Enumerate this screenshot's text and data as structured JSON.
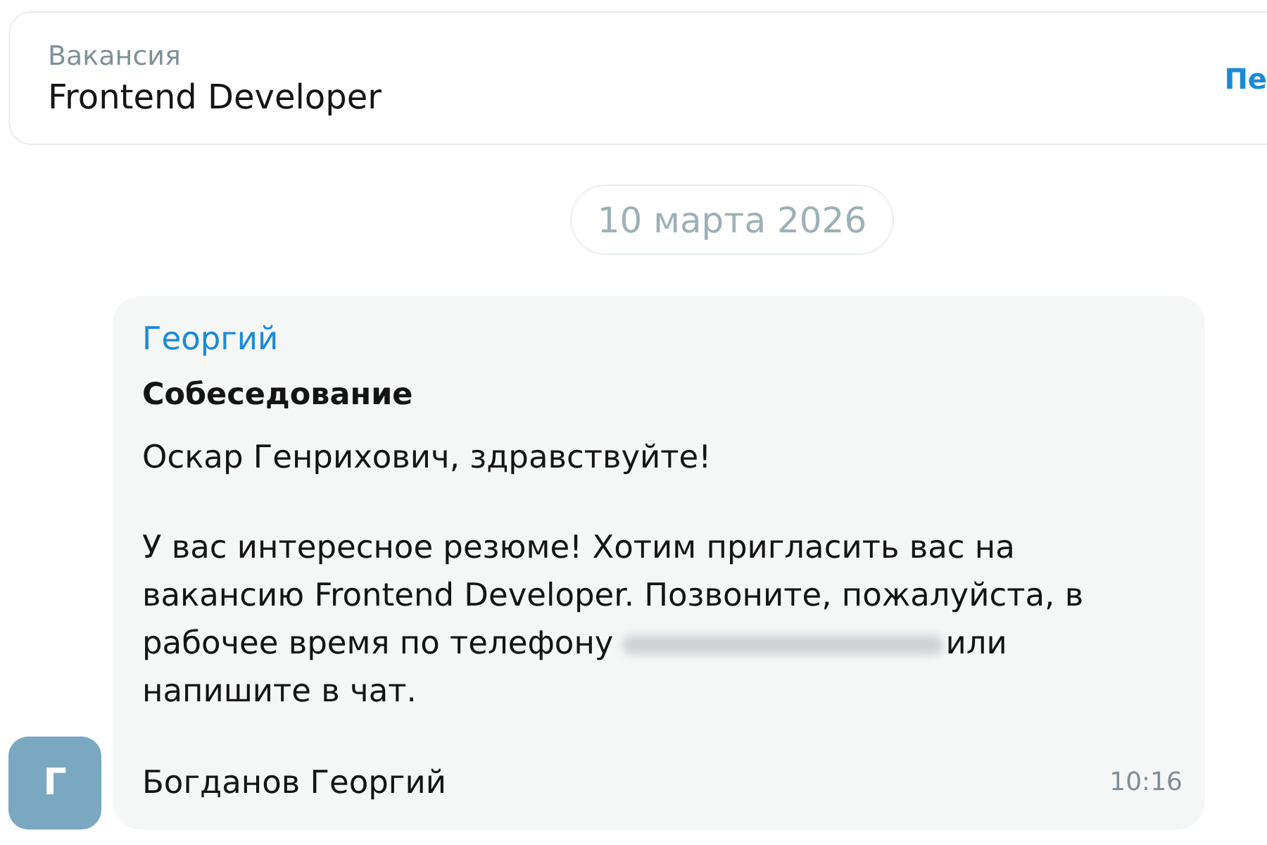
{
  "vacancy_card": {
    "label": "Вакансия",
    "title": "Frontend Developer",
    "link": "Пе"
  },
  "date_divider": "10 марта 2026",
  "message": {
    "author": "Георгий",
    "subject": "Собеседование",
    "greeting": "Оскар Генрихович, здравствуйте!",
    "text_before_phone": "У вас интересное резюме! Хотим пригласить вас на вакансию Frontend Developer. Позвоните, пожалуйста, в рабочее время по телефону",
    "text_after_phone": "или напишите в чат.",
    "avatar_letter": "Г",
    "signature": "Богданов Георгий",
    "time": "10:16"
  }
}
